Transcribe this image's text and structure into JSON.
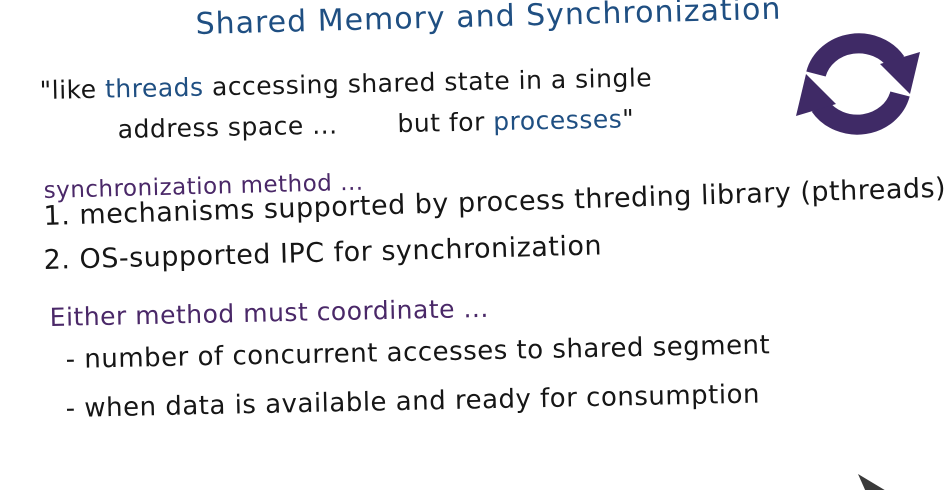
{
  "title": "Shared Memory and Synchronization",
  "quote": {
    "open_quote": "\"",
    "line1_a": "like ",
    "line1_threads": "threads",
    "line1_b": " accessing shared state in a single",
    "line2_a": "address space ...",
    "line2_b": "but for ",
    "line2_processes": "processes",
    "close_quote": "\""
  },
  "sync": {
    "heading": "synchronization method ...",
    "items": [
      "1. mechanisms supported by process threding library (pthreads)",
      "2. OS-supported IPC for synchronization"
    ]
  },
  "either": {
    "heading": "Either method must coordinate ...",
    "bullets": [
      "- number of concurrent accesses to shared segment",
      "- when data is available and ready for consumption"
    ]
  },
  "icons": {
    "cycle": "refresh-cycle-icon",
    "cursor": "pen-cursor-icon"
  },
  "colors": {
    "title_blue": "#1f4f82",
    "ink_black": "#161616",
    "highlight_blue": "#1f4f82",
    "heading_purple": "#4a2868",
    "icon_purple": "#3f2a66"
  }
}
